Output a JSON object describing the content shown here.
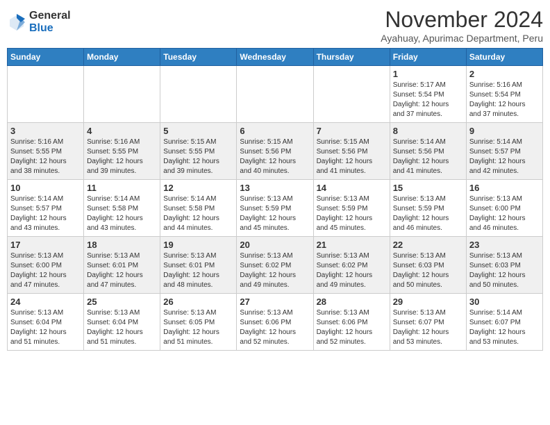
{
  "logo": {
    "general": "General",
    "blue": "Blue"
  },
  "title": "November 2024",
  "location": "Ayahuay, Apurimac Department, Peru",
  "days_of_week": [
    "Sunday",
    "Monday",
    "Tuesday",
    "Wednesday",
    "Thursday",
    "Friday",
    "Saturday"
  ],
  "weeks": [
    [
      {
        "day": "",
        "info": ""
      },
      {
        "day": "",
        "info": ""
      },
      {
        "day": "",
        "info": ""
      },
      {
        "day": "",
        "info": ""
      },
      {
        "day": "",
        "info": ""
      },
      {
        "day": "1",
        "info": "Sunrise: 5:17 AM\nSunset: 5:54 PM\nDaylight: 12 hours\nand 37 minutes."
      },
      {
        "day": "2",
        "info": "Sunrise: 5:16 AM\nSunset: 5:54 PM\nDaylight: 12 hours\nand 37 minutes."
      }
    ],
    [
      {
        "day": "3",
        "info": "Sunrise: 5:16 AM\nSunset: 5:55 PM\nDaylight: 12 hours\nand 38 minutes."
      },
      {
        "day": "4",
        "info": "Sunrise: 5:16 AM\nSunset: 5:55 PM\nDaylight: 12 hours\nand 39 minutes."
      },
      {
        "day": "5",
        "info": "Sunrise: 5:15 AM\nSunset: 5:55 PM\nDaylight: 12 hours\nand 39 minutes."
      },
      {
        "day": "6",
        "info": "Sunrise: 5:15 AM\nSunset: 5:56 PM\nDaylight: 12 hours\nand 40 minutes."
      },
      {
        "day": "7",
        "info": "Sunrise: 5:15 AM\nSunset: 5:56 PM\nDaylight: 12 hours\nand 41 minutes."
      },
      {
        "day": "8",
        "info": "Sunrise: 5:14 AM\nSunset: 5:56 PM\nDaylight: 12 hours\nand 41 minutes."
      },
      {
        "day": "9",
        "info": "Sunrise: 5:14 AM\nSunset: 5:57 PM\nDaylight: 12 hours\nand 42 minutes."
      }
    ],
    [
      {
        "day": "10",
        "info": "Sunrise: 5:14 AM\nSunset: 5:57 PM\nDaylight: 12 hours\nand 43 minutes."
      },
      {
        "day": "11",
        "info": "Sunrise: 5:14 AM\nSunset: 5:58 PM\nDaylight: 12 hours\nand 43 minutes."
      },
      {
        "day": "12",
        "info": "Sunrise: 5:14 AM\nSunset: 5:58 PM\nDaylight: 12 hours\nand 44 minutes."
      },
      {
        "day": "13",
        "info": "Sunrise: 5:13 AM\nSunset: 5:59 PM\nDaylight: 12 hours\nand 45 minutes."
      },
      {
        "day": "14",
        "info": "Sunrise: 5:13 AM\nSunset: 5:59 PM\nDaylight: 12 hours\nand 45 minutes."
      },
      {
        "day": "15",
        "info": "Sunrise: 5:13 AM\nSunset: 5:59 PM\nDaylight: 12 hours\nand 46 minutes."
      },
      {
        "day": "16",
        "info": "Sunrise: 5:13 AM\nSunset: 6:00 PM\nDaylight: 12 hours\nand 46 minutes."
      }
    ],
    [
      {
        "day": "17",
        "info": "Sunrise: 5:13 AM\nSunset: 6:00 PM\nDaylight: 12 hours\nand 47 minutes."
      },
      {
        "day": "18",
        "info": "Sunrise: 5:13 AM\nSunset: 6:01 PM\nDaylight: 12 hours\nand 47 minutes."
      },
      {
        "day": "19",
        "info": "Sunrise: 5:13 AM\nSunset: 6:01 PM\nDaylight: 12 hours\nand 48 minutes."
      },
      {
        "day": "20",
        "info": "Sunrise: 5:13 AM\nSunset: 6:02 PM\nDaylight: 12 hours\nand 49 minutes."
      },
      {
        "day": "21",
        "info": "Sunrise: 5:13 AM\nSunset: 6:02 PM\nDaylight: 12 hours\nand 49 minutes."
      },
      {
        "day": "22",
        "info": "Sunrise: 5:13 AM\nSunset: 6:03 PM\nDaylight: 12 hours\nand 50 minutes."
      },
      {
        "day": "23",
        "info": "Sunrise: 5:13 AM\nSunset: 6:03 PM\nDaylight: 12 hours\nand 50 minutes."
      }
    ],
    [
      {
        "day": "24",
        "info": "Sunrise: 5:13 AM\nSunset: 6:04 PM\nDaylight: 12 hours\nand 51 minutes."
      },
      {
        "day": "25",
        "info": "Sunrise: 5:13 AM\nSunset: 6:04 PM\nDaylight: 12 hours\nand 51 minutes."
      },
      {
        "day": "26",
        "info": "Sunrise: 5:13 AM\nSunset: 6:05 PM\nDaylight: 12 hours\nand 51 minutes."
      },
      {
        "day": "27",
        "info": "Sunrise: 5:13 AM\nSunset: 6:06 PM\nDaylight: 12 hours\nand 52 minutes."
      },
      {
        "day": "28",
        "info": "Sunrise: 5:13 AM\nSunset: 6:06 PM\nDaylight: 12 hours\nand 52 minutes."
      },
      {
        "day": "29",
        "info": "Sunrise: 5:13 AM\nSunset: 6:07 PM\nDaylight: 12 hours\nand 53 minutes."
      },
      {
        "day": "30",
        "info": "Sunrise: 5:14 AM\nSunset: 6:07 PM\nDaylight: 12 hours\nand 53 minutes."
      }
    ]
  ]
}
